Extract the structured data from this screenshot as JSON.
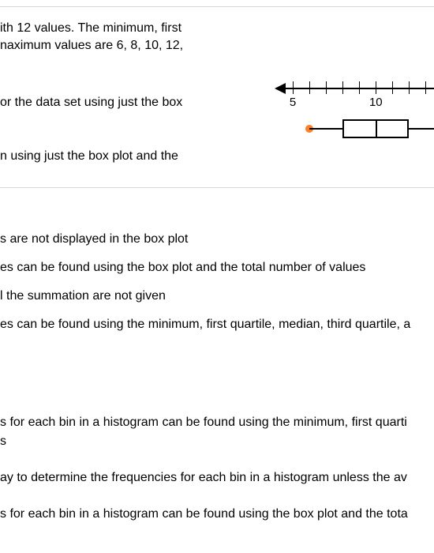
{
  "question": {
    "line1": "ith 12 values. The minimum, first",
    "line2": "naximum values are 6, 8, 10, 12,",
    "line3": "or the data set using just the box",
    "line4": "n using just the box plot and the"
  },
  "answers_a": {
    "a1": "s are not displayed in the box plot",
    "a2": "es can be found using the box plot and the total number of values",
    "a3": "l the summation are not given",
    "a4": "es can be found using the minimum, first quartile, median, third quartile, a"
  },
  "answers_b": {
    "b1": "s for each bin in a histogram can be found using the minimum, first quarti",
    "b1b": "s",
    "b2": "ay to determine the frequencies for each bin in a histogram unless the av",
    "b3": "s for each bin in a histogram can be found using the box plot and the tota"
  },
  "chart_data": {
    "type": "boxplot",
    "axis_start": 4,
    "axis_end": 13.5,
    "tick_start": 5,
    "tick_step": 1,
    "tick_count": 9,
    "tick_labels_shown": {
      "5": "5",
      "10": "10"
    },
    "min": 6,
    "q1": 8,
    "median": 10,
    "q3": 12,
    "max_visible": 13.5,
    "min_is_outlier_style": true,
    "outlier_color": "#ff7f27"
  }
}
